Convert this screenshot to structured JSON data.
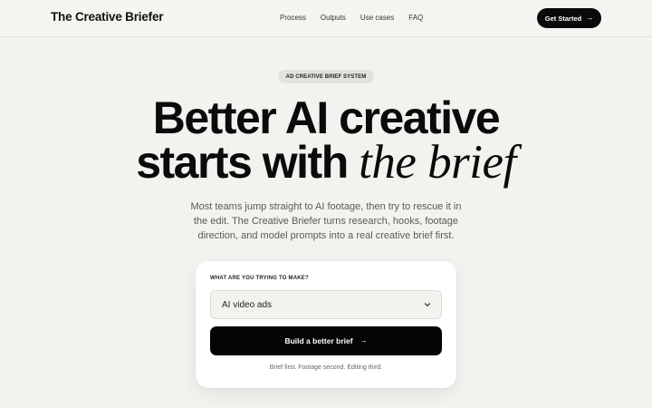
{
  "header": {
    "logo": "The Creative Briefer",
    "nav": [
      "Process",
      "Outputs",
      "Use cases",
      "FAQ"
    ],
    "cta_label": "Get Started"
  },
  "hero": {
    "badge": "AD CREATIVE BRIEF SYSTEM",
    "headline_line1": "Better AI creative",
    "headline_line2_plain": "starts with",
    "headline_line2_italic": "the brief",
    "subtext": "Most teams jump straight to AI footage, then try to rescue it in the edit. The Creative Briefer turns research, hooks, footage direction, and model prompts into a real creative brief first."
  },
  "form": {
    "label": "WHAT ARE YOU TRYING TO MAKE?",
    "select_value": "AI video ads",
    "button_label": "Build a better brief",
    "note": "Brief first. Footage second. Editing third."
  },
  "icons": {
    "cta_arrow": "arrow-right-icon",
    "button_arrow": "arrow-right-icon",
    "select_chevron": "chevron-down-icon"
  },
  "colors": {
    "background": "#f3f2ef",
    "primary": "#0a0a0a",
    "card": "#ffffff",
    "badge": "#e4e2dd"
  }
}
